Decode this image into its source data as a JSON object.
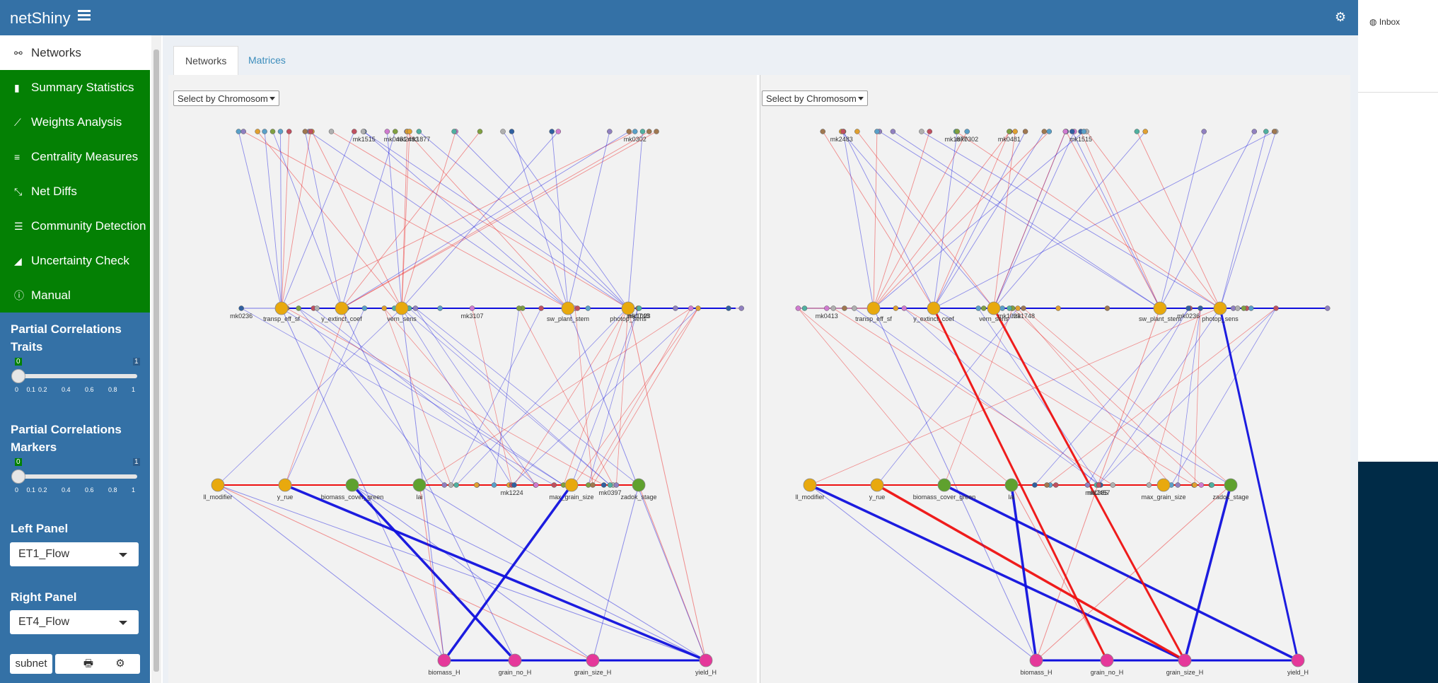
{
  "app": {
    "title": "netShiny"
  },
  "menu": [
    {
      "label": "Networks",
      "icon": "network-icon",
      "active": true
    },
    {
      "label": "Summary Statistics",
      "icon": "bar-chart-icon",
      "active": false
    },
    {
      "label": "Weights Analysis",
      "icon": "line-chart-icon",
      "active": false
    },
    {
      "label": "Centrality Measures",
      "icon": "align-center-icon",
      "active": false
    },
    {
      "label": "Net Diffs",
      "icon": "compress-icon",
      "active": false
    },
    {
      "label": "Community Detection",
      "icon": "list-icon",
      "active": false
    },
    {
      "label": "Uncertainty Check",
      "icon": "area-chart-icon",
      "active": false
    },
    {
      "label": "Manual",
      "icon": "info-icon",
      "active": false
    }
  ],
  "sliders": {
    "traits": {
      "label": "Partial Correlations Traits",
      "value": "0",
      "max": "1",
      "ticks": [
        "0",
        "0.1",
        "0.2",
        "0.4",
        "0.6",
        "0.8",
        "1"
      ]
    },
    "markers": {
      "label": "Partial Correlations Markers",
      "value": "0",
      "max": "1",
      "ticks": [
        "0",
        "0.1",
        "0.2",
        "0.4",
        "0.6",
        "0.8",
        "1"
      ]
    }
  },
  "panels": {
    "left": {
      "label": "Left Panel",
      "value": "ET1_Flow"
    },
    "right": {
      "label": "Right Panel",
      "value": "ET4_Flow"
    }
  },
  "buttons": {
    "subnet": "subnet"
  },
  "tabs": [
    {
      "label": "Networks",
      "active": true
    },
    {
      "label": "Matrices",
      "active": false
    }
  ],
  "chromosome_select": {
    "placeholder": "Select by Chromosom"
  },
  "browser": {
    "bookmark": "Inbox"
  },
  "colors": {
    "topbar": "#3471a6",
    "menu_green": "#048004",
    "trait_node": "#e8a90e",
    "green_node": "#5fa12e",
    "pink_node": "#e5389a",
    "pos_edge": "#ee1010",
    "neg_edge": "#1010dd"
  },
  "networks": {
    "left": {
      "trait_nodes": [
        "ll_modifier",
        "y_rue",
        "biomass_cover_green",
        "lai",
        "max_grain_size",
        "zadok_stage",
        "transp_eff_sf",
        "y_extinct_coef",
        "vern_sens",
        "sw_plant_stem",
        "photop_sens"
      ],
      "yield_nodes": [
        "biomass_H",
        "grain_no_H",
        "grain_size_H",
        "yield_H"
      ],
      "marker_labels": [
        "mk0302",
        "mk0481",
        "mk2483",
        "mk1515",
        "mk1877",
        "mk0236",
        "mk1748",
        "mk1023",
        "mk3107",
        "mk0397",
        "mk1224"
      ]
    },
    "right": {
      "trait_nodes": [
        "ll_modifier",
        "y_rue",
        "biomass_cover_green",
        "lai",
        "max_grain_size",
        "zadok_stage",
        "transp_eff_sf",
        "y_extinct_coef",
        "vern_sens",
        "sw_plant_stem",
        "photop_sens"
      ],
      "yield_nodes": [
        "biomass_H",
        "grain_no_H",
        "grain_size_H",
        "yield_H"
      ],
      "marker_labels": [
        "mk0302",
        "mk0481",
        "mk2483",
        "mk1515",
        "mk1877",
        "mk0236",
        "mk1748",
        "mk1023",
        "mk0413",
        "mk1285",
        "mk2457"
      ]
    }
  }
}
